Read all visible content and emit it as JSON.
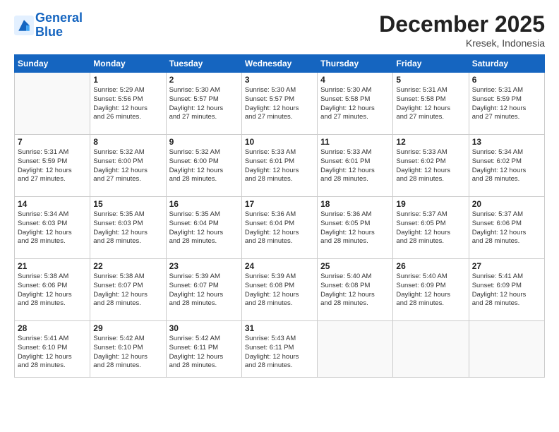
{
  "header": {
    "logo_line1": "General",
    "logo_line2": "Blue",
    "month_title": "December 2025",
    "location": "Kresek, Indonesia"
  },
  "days_of_week": [
    "Sunday",
    "Monday",
    "Tuesday",
    "Wednesday",
    "Thursday",
    "Friday",
    "Saturday"
  ],
  "weeks": [
    [
      {
        "day": "",
        "info": ""
      },
      {
        "day": "1",
        "info": "Sunrise: 5:29 AM\nSunset: 5:56 PM\nDaylight: 12 hours\nand 26 minutes."
      },
      {
        "day": "2",
        "info": "Sunrise: 5:30 AM\nSunset: 5:57 PM\nDaylight: 12 hours\nand 27 minutes."
      },
      {
        "day": "3",
        "info": "Sunrise: 5:30 AM\nSunset: 5:57 PM\nDaylight: 12 hours\nand 27 minutes."
      },
      {
        "day": "4",
        "info": "Sunrise: 5:30 AM\nSunset: 5:58 PM\nDaylight: 12 hours\nand 27 minutes."
      },
      {
        "day": "5",
        "info": "Sunrise: 5:31 AM\nSunset: 5:58 PM\nDaylight: 12 hours\nand 27 minutes."
      },
      {
        "day": "6",
        "info": "Sunrise: 5:31 AM\nSunset: 5:59 PM\nDaylight: 12 hours\nand 27 minutes."
      }
    ],
    [
      {
        "day": "7",
        "info": "Sunrise: 5:31 AM\nSunset: 5:59 PM\nDaylight: 12 hours\nand 27 minutes."
      },
      {
        "day": "8",
        "info": "Sunrise: 5:32 AM\nSunset: 6:00 PM\nDaylight: 12 hours\nand 27 minutes."
      },
      {
        "day": "9",
        "info": "Sunrise: 5:32 AM\nSunset: 6:00 PM\nDaylight: 12 hours\nand 28 minutes."
      },
      {
        "day": "10",
        "info": "Sunrise: 5:33 AM\nSunset: 6:01 PM\nDaylight: 12 hours\nand 28 minutes."
      },
      {
        "day": "11",
        "info": "Sunrise: 5:33 AM\nSunset: 6:01 PM\nDaylight: 12 hours\nand 28 minutes."
      },
      {
        "day": "12",
        "info": "Sunrise: 5:33 AM\nSunset: 6:02 PM\nDaylight: 12 hours\nand 28 minutes."
      },
      {
        "day": "13",
        "info": "Sunrise: 5:34 AM\nSunset: 6:02 PM\nDaylight: 12 hours\nand 28 minutes."
      }
    ],
    [
      {
        "day": "14",
        "info": "Sunrise: 5:34 AM\nSunset: 6:03 PM\nDaylight: 12 hours\nand 28 minutes."
      },
      {
        "day": "15",
        "info": "Sunrise: 5:35 AM\nSunset: 6:03 PM\nDaylight: 12 hours\nand 28 minutes."
      },
      {
        "day": "16",
        "info": "Sunrise: 5:35 AM\nSunset: 6:04 PM\nDaylight: 12 hours\nand 28 minutes."
      },
      {
        "day": "17",
        "info": "Sunrise: 5:36 AM\nSunset: 6:04 PM\nDaylight: 12 hours\nand 28 minutes."
      },
      {
        "day": "18",
        "info": "Sunrise: 5:36 AM\nSunset: 6:05 PM\nDaylight: 12 hours\nand 28 minutes."
      },
      {
        "day": "19",
        "info": "Sunrise: 5:37 AM\nSunset: 6:05 PM\nDaylight: 12 hours\nand 28 minutes."
      },
      {
        "day": "20",
        "info": "Sunrise: 5:37 AM\nSunset: 6:06 PM\nDaylight: 12 hours\nand 28 minutes."
      }
    ],
    [
      {
        "day": "21",
        "info": "Sunrise: 5:38 AM\nSunset: 6:06 PM\nDaylight: 12 hours\nand 28 minutes."
      },
      {
        "day": "22",
        "info": "Sunrise: 5:38 AM\nSunset: 6:07 PM\nDaylight: 12 hours\nand 28 minutes."
      },
      {
        "day": "23",
        "info": "Sunrise: 5:39 AM\nSunset: 6:07 PM\nDaylight: 12 hours\nand 28 minutes."
      },
      {
        "day": "24",
        "info": "Sunrise: 5:39 AM\nSunset: 6:08 PM\nDaylight: 12 hours\nand 28 minutes."
      },
      {
        "day": "25",
        "info": "Sunrise: 5:40 AM\nSunset: 6:08 PM\nDaylight: 12 hours\nand 28 minutes."
      },
      {
        "day": "26",
        "info": "Sunrise: 5:40 AM\nSunset: 6:09 PM\nDaylight: 12 hours\nand 28 minutes."
      },
      {
        "day": "27",
        "info": "Sunrise: 5:41 AM\nSunset: 6:09 PM\nDaylight: 12 hours\nand 28 minutes."
      }
    ],
    [
      {
        "day": "28",
        "info": "Sunrise: 5:41 AM\nSunset: 6:10 PM\nDaylight: 12 hours\nand 28 minutes."
      },
      {
        "day": "29",
        "info": "Sunrise: 5:42 AM\nSunset: 6:10 PM\nDaylight: 12 hours\nand 28 minutes."
      },
      {
        "day": "30",
        "info": "Sunrise: 5:42 AM\nSunset: 6:11 PM\nDaylight: 12 hours\nand 28 minutes."
      },
      {
        "day": "31",
        "info": "Sunrise: 5:43 AM\nSunset: 6:11 PM\nDaylight: 12 hours\nand 28 minutes."
      },
      {
        "day": "",
        "info": ""
      },
      {
        "day": "",
        "info": ""
      },
      {
        "day": "",
        "info": ""
      }
    ]
  ]
}
